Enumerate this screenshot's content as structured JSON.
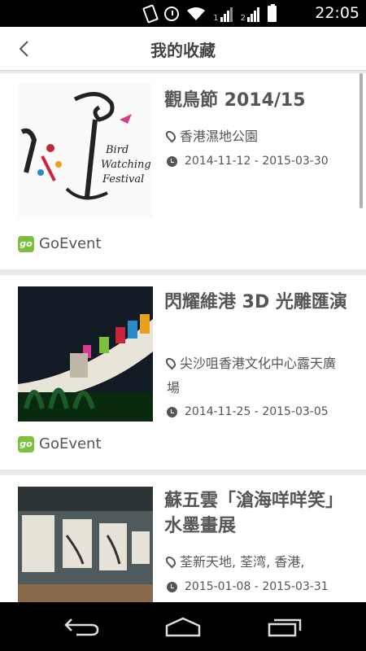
{
  "status_bar": {
    "time": "22:05",
    "sim2_label": "2",
    "sim1_label": "1",
    "icons": [
      "vibrate-icon",
      "alarm-icon",
      "wifi-icon",
      "signal-icon",
      "battery-icon"
    ]
  },
  "header": {
    "title": "我的收藏",
    "back_icon": "chevron-left-icon"
  },
  "events": [
    {
      "title": "觀鳥節 2014/15",
      "location": "香港濕地公園",
      "date_range": "2014-11-12 - 2015-03-30",
      "source": "GoEvent",
      "image_text": {
        "line1": "Bird",
        "line2": "Watching",
        "line3": "Festival"
      }
    },
    {
      "title": "閃耀維港 3D 光雕匯演",
      "location": "尖沙咀香港文化中心露天廣場",
      "date_range": "2014-11-25 - 2015-03-05",
      "source": "GoEvent"
    },
    {
      "title": "蘇五雲「滄海咩咩笑」水墨畫展",
      "location": "荃新天地, 荃湾, 香港,",
      "date_range": "2015-01-08 - 2015-03-31"
    }
  ],
  "source_logo_text": "go",
  "nav": {
    "back_icon": "back-arrow-icon",
    "home_icon": "home-icon",
    "recents_icon": "recent-apps-icon"
  },
  "colors": {
    "brand_green": "#7cc13d",
    "text": "#555555",
    "background": "#e9e9e9"
  }
}
